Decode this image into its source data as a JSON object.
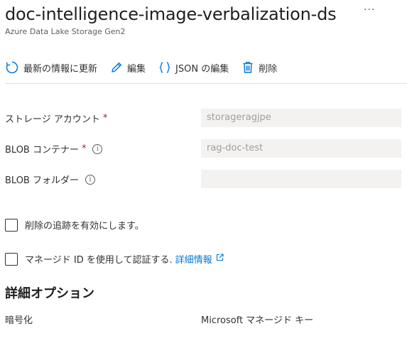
{
  "header": {
    "title": "doc-intelligence-image-verbalization-ds",
    "subtitle": "Azure Data Lake Storage Gen2",
    "more_label": "···"
  },
  "toolbar": {
    "refresh_label": "最新の情報に更新",
    "edit_label": "編集",
    "edit_json_label": "JSON の編集",
    "delete_label": "削除"
  },
  "form": {
    "storage_account": {
      "label": "ストレージ アカウント",
      "required_mark": "*",
      "value": "storageragjpe"
    },
    "blob_container": {
      "label": "BLOB コンテナー",
      "required_mark": "*",
      "value": "rag-doc-test"
    },
    "blob_folder": {
      "label": "BLOB フォルダー",
      "value": ""
    },
    "deletion_tracking": {
      "label": "削除の追跡を有効にします。",
      "checked": false
    },
    "managed_identity": {
      "label": "マネージド ID を使用して認証する.",
      "link_label": "詳細情報",
      "checked": false
    }
  },
  "advanced": {
    "title": "詳細オプション",
    "encryption_label": "暗号化",
    "encryption_value": "Microsoft マネージド キー"
  },
  "colors": {
    "accent": "#0078d4",
    "required": "#a4262c",
    "input_bg": "#f3f2f1"
  }
}
